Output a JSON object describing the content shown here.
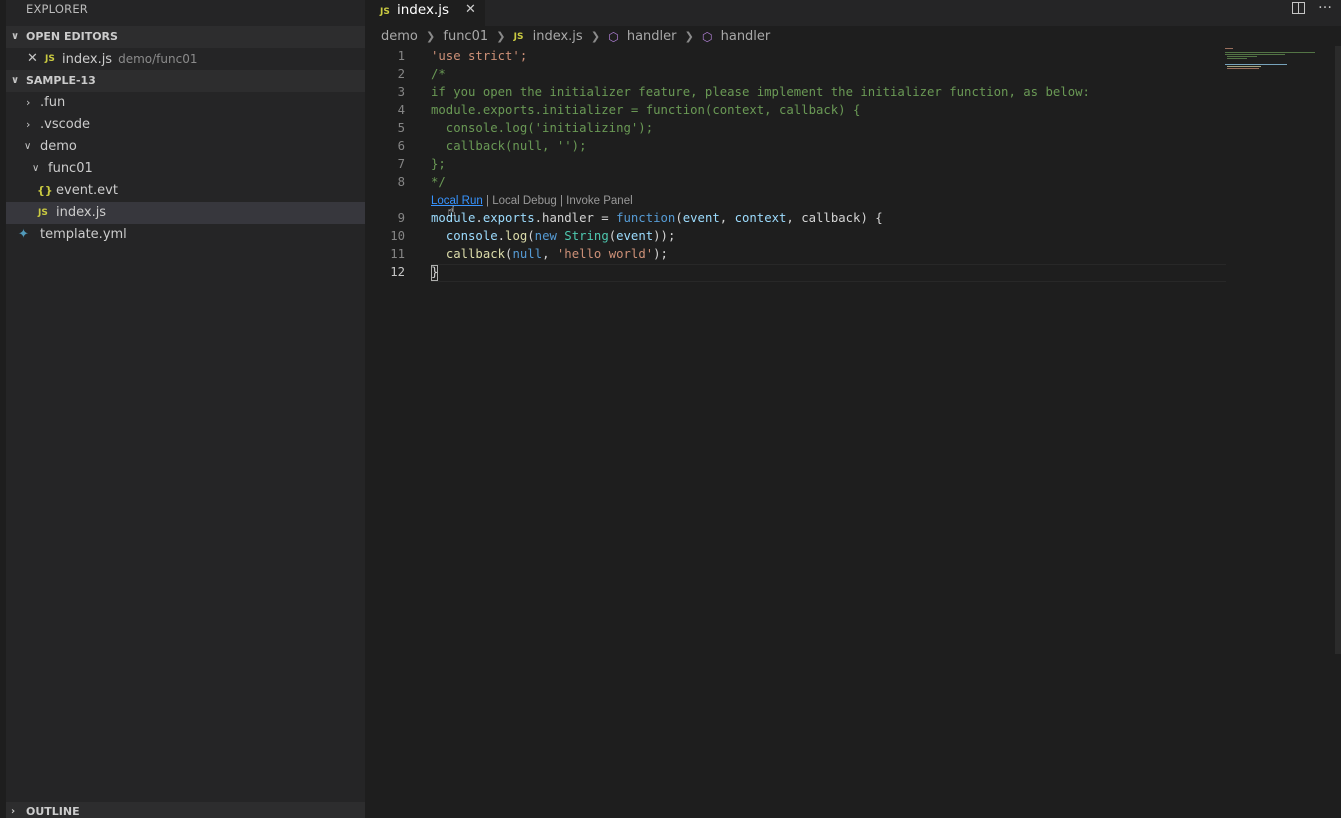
{
  "sidebar": {
    "title": "EXPLORER",
    "open_editors": {
      "header": "OPEN EDITORS",
      "items": [
        {
          "name": "index.js",
          "description": "demo/func01",
          "icon": "js-file-icon"
        }
      ]
    },
    "workspace": {
      "header": "SAMPLE-13",
      "items": [
        {
          "name": ".fun",
          "type": "folder",
          "expanded": false
        },
        {
          "name": ".vscode",
          "type": "folder",
          "expanded": false
        },
        {
          "name": "demo",
          "type": "folder",
          "expanded": true
        },
        {
          "name": "func01",
          "type": "folder",
          "expanded": true
        },
        {
          "name": "event.evt",
          "type": "file",
          "icon": "json-file-icon"
        },
        {
          "name": "index.js",
          "type": "file",
          "icon": "js-file-icon",
          "selected": true
        },
        {
          "name": "template.yml",
          "type": "file",
          "icon": "yml-file-icon"
        }
      ]
    },
    "outline": {
      "header": "OUTLINE"
    }
  },
  "tabs": [
    {
      "label": "index.js",
      "icon_text": "JS",
      "active": true
    }
  ],
  "breadcrumb": {
    "items": [
      "demo",
      "func01",
      "index.js",
      "handler",
      "handler"
    ],
    "js_icon_text": "JS"
  },
  "code": {
    "lines": [
      {
        "n": "1",
        "text": "'use strict';"
      },
      {
        "n": "2",
        "text": "/*"
      },
      {
        "n": "3",
        "text": "if you open the initializer feature, please implement the initializer function, as below:"
      },
      {
        "n": "4",
        "text": "module.exports.initializer = function(context, callback) {"
      },
      {
        "n": "5",
        "text": "  console.log('initializing');"
      },
      {
        "n": "6",
        "text": "  callback(null, '');"
      },
      {
        "n": "7",
        "text": "};"
      },
      {
        "n": "8",
        "text": "*/"
      },
      {
        "n": "9",
        "text": "module.exports.handler = function(event, context, callback) {"
      },
      {
        "n": "10",
        "text": "  console.log(new String(event));"
      },
      {
        "n": "11",
        "text": "  callback(null, 'hello world');"
      },
      {
        "n": "12",
        "text": "}"
      }
    ],
    "codelens": {
      "local_run": "Local Run",
      "separator": " | ",
      "local_debug": "Local Debug",
      "invoke_panel": "Invoke Panel"
    }
  },
  "colors": {
    "background": "#1e1e1e",
    "sidebar": "#252526",
    "comment": "#6a9955",
    "string": "#ce9178",
    "keyword": "#569cd6",
    "link": "#3794ff"
  }
}
